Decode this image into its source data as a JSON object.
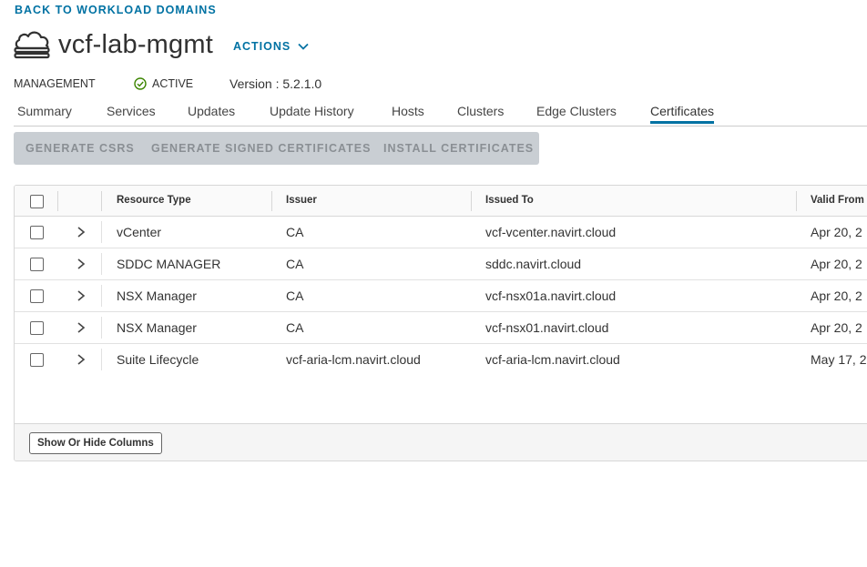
{
  "nav": {
    "back_label": "BACK TO WORKLOAD DOMAINS"
  },
  "header": {
    "title": "vcf-lab-mgmt",
    "actions_label": "ACTIONS",
    "domain_type": "MANAGEMENT",
    "status": "ACTIVE",
    "version": "Version : 5.2.1.0"
  },
  "tabs": [
    {
      "label": "Summary"
    },
    {
      "label": "Services"
    },
    {
      "label": "Updates"
    },
    {
      "label": "Update History"
    },
    {
      "label": "Hosts"
    },
    {
      "label": "Clusters"
    },
    {
      "label": "Edge Clusters"
    },
    {
      "label": "Certificates",
      "active": true
    }
  ],
  "toolbar": {
    "generate_csrs": "GENERATE CSRS",
    "generate_signed": "GENERATE SIGNED CERTIFICATES",
    "install": "INSTALL CERTIFICATES"
  },
  "table": {
    "columns": [
      "Resource Type",
      "Issuer",
      "Issued To",
      "Valid From"
    ],
    "rows": [
      [
        "vCenter",
        "CA",
        "vcf-vcenter.navirt.cloud",
        "Apr 20, 2"
      ],
      [
        "SDDC MANAGER",
        "CA",
        "sddc.navirt.cloud",
        "Apr 20, 2"
      ],
      [
        "NSX Manager",
        "CA",
        "vcf-nsx01a.navirt.cloud",
        "Apr 20, 2"
      ],
      [
        "NSX Manager",
        "CA",
        "vcf-nsx01.navirt.cloud",
        "Apr 20, 2"
      ],
      [
        "Suite Lifecycle",
        "vcf-aria-lcm.navirt.cloud",
        "vcf-aria-lcm.navirt.cloud",
        "May 17, 2"
      ]
    ],
    "show_hide_label": "Show Or Hide Columns"
  },
  "colors": {
    "accent": "#0072a3",
    "status_ok": "#3c8500",
    "toolbar_bg": "#c9ced3"
  },
  "icons": {
    "domain": "cloud-icon",
    "actions": "chevron-down-icon",
    "status": "check-circle-icon",
    "row_expand": "chevron-right-icon"
  }
}
